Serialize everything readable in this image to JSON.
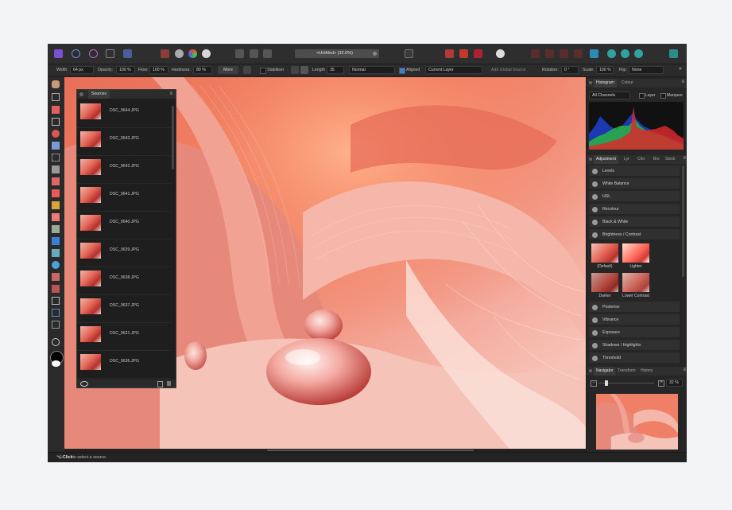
{
  "toolbar": {
    "document_title": "<Untitled> (32.0%)"
  },
  "context": {
    "width_label": "Width:",
    "width_value": "64 px",
    "opacity_label": "Opacity:",
    "opacity_value": "100 %",
    "flow_label": "Flow:",
    "flow_value": "100 %",
    "hardness_label": "Hardness:",
    "hardness_value": "80 %",
    "more_label": "More",
    "stabiliser_label": "Stabiliser",
    "length_label": "Length",
    "length_value": "35",
    "blend_mode": "Normal",
    "aligned_label": "Aligned",
    "source_layer": "Current Layer",
    "add_global_source": "Add Global Source",
    "rotation_label": "Rotation:",
    "rotation_value": "0 °",
    "scale_label": "Scale:",
    "scale_value": "100 %",
    "flip_label": "Flip:",
    "flip_value": "None"
  },
  "sources": {
    "tab": "Sources",
    "items": [
      "DSC_9644.JPG",
      "DSC_9643.JPG",
      "DSC_9642.JPG",
      "DSC_9641.JPG",
      "DSC_9640.JPG",
      "DSC_9639.JPG",
      "DSC_9638.JPG",
      "DSC_9637.JPG",
      "DSC_9621.JPG",
      "DSC_9636.JPG"
    ]
  },
  "histogram": {
    "tabs": [
      "Histogram",
      "Colour"
    ],
    "channel": "All Channels",
    "layer_label": "Layer",
    "marquee_label": "Marquee"
  },
  "adjustment": {
    "tabs": [
      "Adjustment",
      "Lyr",
      "Chn",
      "Brs",
      "Stock"
    ],
    "items_top": [
      "Levels",
      "White Balance",
      "HSL",
      "Recolour",
      "Black & White",
      "Brightness / Contrast"
    ],
    "presets": [
      "(Default)",
      "Lighter",
      "Darker",
      "Lower Contrast"
    ],
    "items_bottom": [
      "Posterise",
      "Vibrance",
      "Exposure",
      "Shadows / Highlights",
      "Threshold"
    ]
  },
  "navigator": {
    "tabs": [
      "Navigator",
      "Transform",
      "History"
    ],
    "zoom": "32 %"
  },
  "status": {
    "key": "⌥-Click",
    "text": " to select a source."
  },
  "colors": {
    "accent": "#3d7fd6",
    "panel": "#262626",
    "toolbar": "#2e2e2e"
  }
}
